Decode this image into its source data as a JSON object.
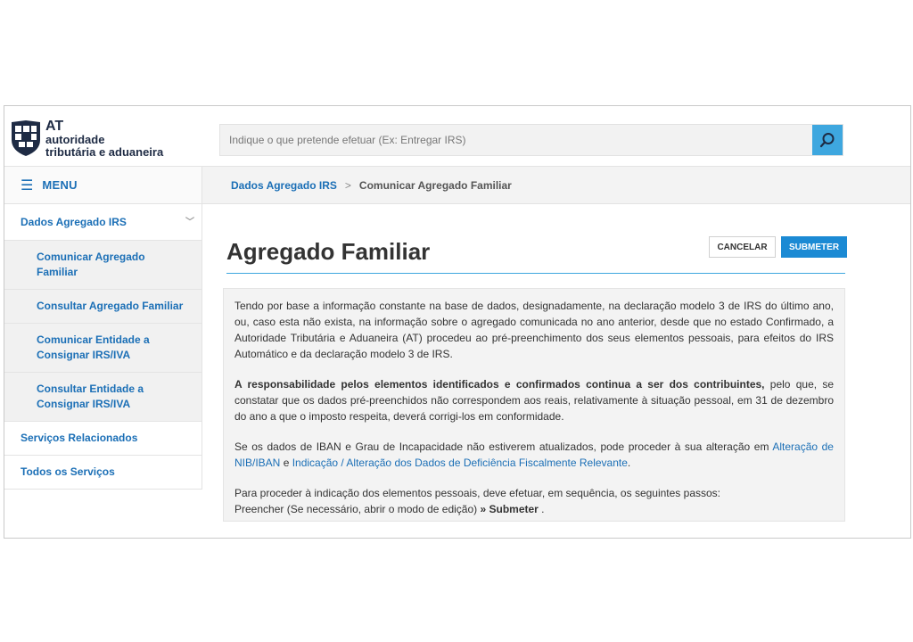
{
  "header": {
    "logo": {
      "at": "AT",
      "line1": "autoridade",
      "line2": "tributária e aduaneira"
    },
    "search": {
      "placeholder": "Indique o que pretende efetuar (Ex: Entregar IRS)",
      "value": ""
    }
  },
  "sidebar": {
    "menu_label": "MENU",
    "items": [
      {
        "label": "Dados Agregado IRS",
        "kind": "parent"
      },
      {
        "label": "Comunicar Agregado Familiar",
        "kind": "sub"
      },
      {
        "label": "Consultar Agregado Familiar",
        "kind": "sub"
      },
      {
        "label": "Comunicar Entidade a Consignar IRS/IVA",
        "kind": "sub"
      },
      {
        "label": "Consultar Entidade a Consignar IRS/IVA",
        "kind": "sub"
      },
      {
        "label": "Serviços Relacionados",
        "kind": "top"
      },
      {
        "label": "Todos os Serviços",
        "kind": "top"
      }
    ]
  },
  "breadcrumb": {
    "link": "Dados Agregado IRS",
    "separator": ">",
    "current": "Comunicar Agregado Familiar"
  },
  "page": {
    "title": "Agregado Familiar",
    "cancel_label": "CANCELAR",
    "submit_label": "SUBMETER"
  },
  "info": {
    "p1": "Tendo por base a informação constante na base de dados, designadamente, na declaração modelo 3 de IRS do último ano, ou, caso esta não exista, na informação sobre o agregado comunicada no ano anterior, desde que no estado Confirmado, a Autoridade Tributária e Aduaneira (AT) procedeu ao pré-preenchimento dos seus elementos pessoais, para efeitos do IRS Automático e da declaração modelo 3 de IRS.",
    "p2_bold": "A responsabilidade pelos elementos identificados e confirmados continua a ser dos contribuintes,",
    "p2_rest": " pelo que, se constatar que os dados pré-preenchidos não correspondem aos reais, relativamente à situação pessoal, em 31 de dezembro do ano a que o imposto respeita, deverá corrigi-los em conformidade.",
    "p3_start": "Se os dados de IBAN e Grau de Incapacidade não estiverem atualizados, pode proceder à sua alteração em ",
    "p3_link1": "Alteração de NIB/IBAN",
    "p3_mid": " e ",
    "p3_link2": "Indicação / Alteração dos Dados de Deficiência Fiscalmente Relevante",
    "p3_end": ".",
    "p4_line1": "Para proceder à indicação dos elementos pessoais, deve efetuar, em sequência, os seguintes passos:",
    "p4_line2_start": "Preencher (Se necessário, abrir o modo de edição) ",
    "p4_line2_bold": "» Submeter",
    "p4_line2_end": " ."
  },
  "colors": {
    "accent": "#1b8ad4",
    "link": "#1b6fb6",
    "search_button": "#3ea7df",
    "panel_bg": "#f3f3f3"
  },
  "icons": {
    "menu": "hamburger-icon",
    "search": "search-icon",
    "chevron": "chevron-down-icon",
    "logo": "at-logo-icon"
  }
}
